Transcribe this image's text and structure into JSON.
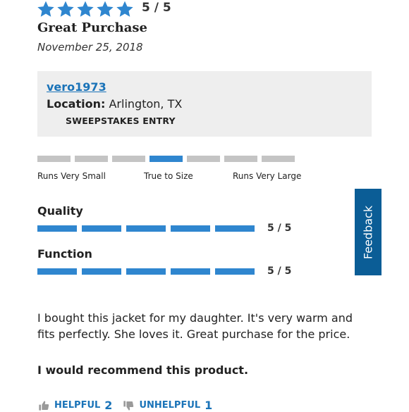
{
  "rating": {
    "stars_filled": 5,
    "stars_total": 5,
    "score_text": "5 / 5",
    "star_color": "#2f86cf"
  },
  "review": {
    "title": "Great Purchase",
    "date": "November 25, 2018",
    "body": "I bought this jacket for my daughter. It's very warm and fits perfectly. She loves it. Great purchase for the price.",
    "recommendation": "I would recommend this product."
  },
  "reviewer": {
    "username": "vero1973",
    "location_label": "Location:",
    "location_value": "Arlington, TX",
    "badge": "SWEEPSTAKES ENTRY"
  },
  "fit": {
    "segments_total": 7,
    "selected_index": 3,
    "labels": [
      "Runs Very Small",
      "True to Size",
      "Runs Very Large"
    ]
  },
  "ratings": [
    {
      "name": "Quality",
      "score": 5,
      "max": 5,
      "score_text": "5 / 5"
    },
    {
      "name": "Function",
      "score": 5,
      "max": 5,
      "score_text": "5 / 5"
    }
  ],
  "feedback_tab": {
    "label": "Feedback",
    "color": "#0b5d96"
  },
  "votes": {
    "helpful_label": "HELPFUL",
    "helpful_count": "2",
    "unhelpful_label": "UNHELPFUL",
    "unhelpful_count": "1",
    "helpful_icon": "thumbs-up-icon",
    "unhelpful_icon": "thumbs-down-icon"
  }
}
